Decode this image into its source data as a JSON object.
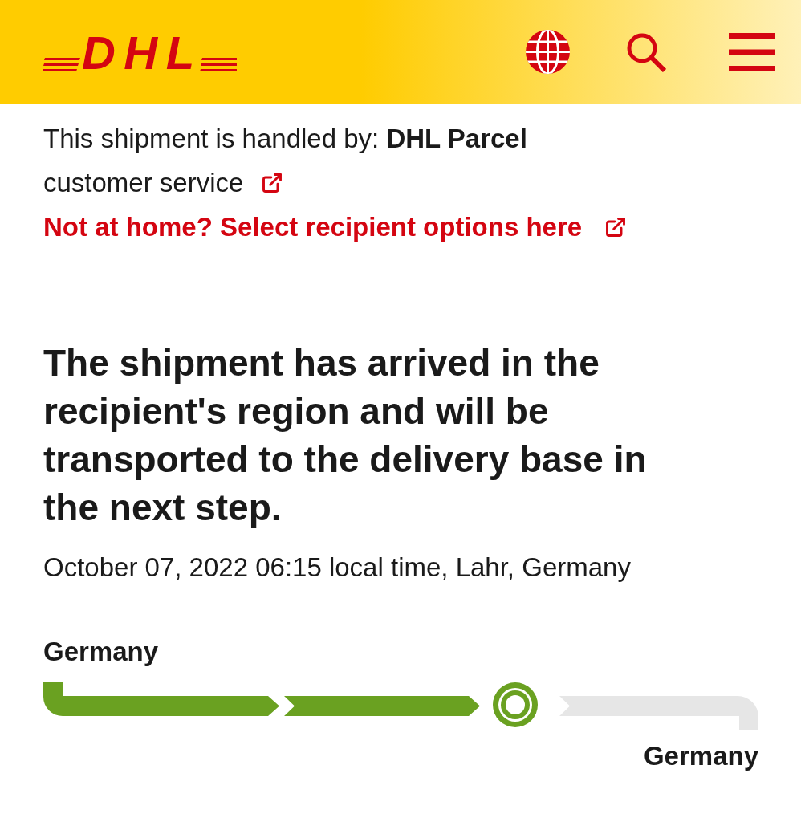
{
  "header": {
    "logo": "DHL"
  },
  "handler": {
    "text": "This shipment is handled by: **DHL Parcel**",
    "customer_service_link": "customer service",
    "recipient_options_link": "Not at home? Select recipient options here"
  },
  "status": {
    "headline": "The shipment has arrived in the recipient's region and will be transported to the delivery base in the next step.",
    "timestamp": "October 07, 2022 06:15 local time, Lahr, Germany"
  },
  "route": {
    "origin": "Germany",
    "destination": "Germany",
    "legs": [
      {
        "completed": true
      },
      {
        "completed": true
      },
      {
        "completed": false
      }
    ]
  }
}
